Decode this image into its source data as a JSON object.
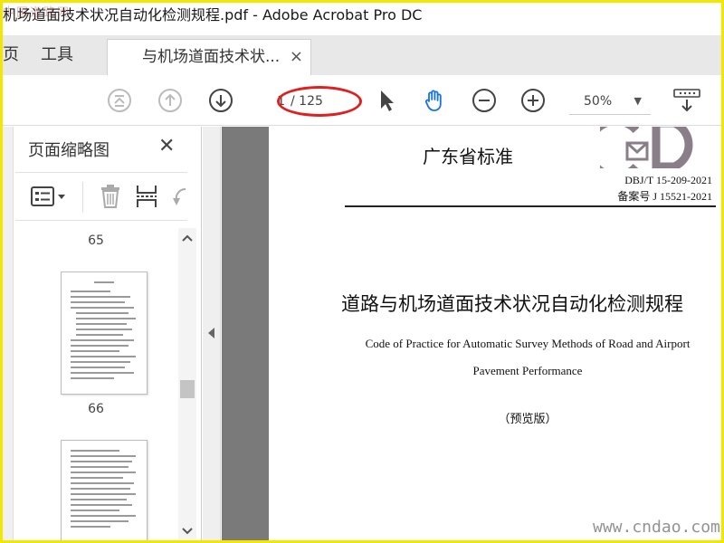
{
  "window": {
    "title": "机场道面技术状况自动化检测规程.pdf - Adobe Acrobat Pro DC",
    "watermark_top": "中国道路网"
  },
  "tabs": {
    "left_partial": "页",
    "tools": "工具",
    "active": "与机场道面技术状...",
    "close": "×"
  },
  "toolbar": {
    "icons": [
      "first-page-icon",
      "previous-page-icon",
      "next-page-icon",
      "select-cursor-icon",
      "hand-tool-icon",
      "zoom-out-icon",
      "zoom-in-icon",
      "more-tools-icon"
    ],
    "page_current": "1",
    "page_total": "/ 125",
    "zoom": "50%",
    "zoom_caret": "▼"
  },
  "sidebar": {
    "title": "页面缩略图",
    "close": "✕",
    "thumbnails": [
      {
        "label": "65"
      },
      {
        "label": "66"
      }
    ]
  },
  "document": {
    "standard_title": "广东省标准",
    "logo_text": "GD",
    "standard_code": "DBJ/T 15-209-2021",
    "record_number": "备案号 J 15521-2021",
    "title_cn": "道路与机场道面技术状况自动化检测规程",
    "title_en_line1": "Code of Practice for Automatic Survey Methods of Road and Airport",
    "title_en_line2": "Pavement Performance",
    "preview_note": "（预览版）"
  },
  "watermark_bottom": "www.cndao.com",
  "colors": {
    "frame_border": "#f3e600",
    "annotation_oval": "#e02020",
    "hand_tool_blue": "#1473e6"
  }
}
